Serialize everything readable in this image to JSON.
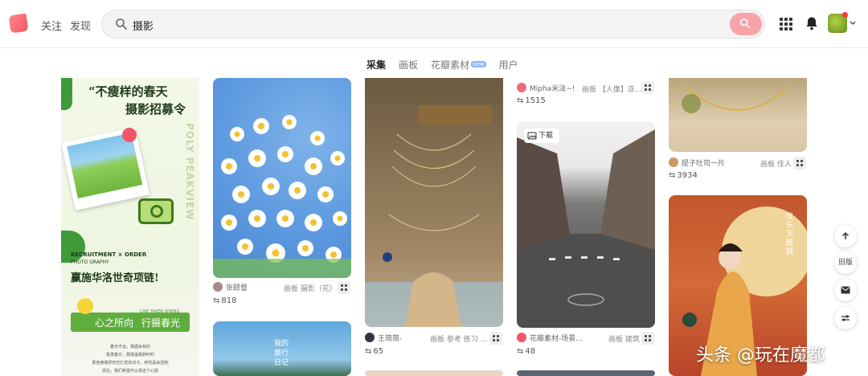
{
  "header": {
    "nav": [
      "关注",
      "发现"
    ],
    "search_value": "摄影"
  },
  "tabs": [
    {
      "label": "采集",
      "active": true
    },
    {
      "label": "画板",
      "active": false
    },
    {
      "label": "花瓣素材",
      "active": false,
      "badge": "new"
    },
    {
      "label": "用户",
      "active": false
    }
  ],
  "pins": {
    "poster": {
      "headline_1": "“不瘦样的春天",
      "headline_2": "摄影招募令",
      "vertical": "POLY PEAKVIEW",
      "recruit": "RECRUITMENT × ORDER",
      "photo": "PHOTO GRAPHY",
      "slogan": "赢施华洛世奇项链!",
      "spring_en": "LINE TAKEN SPRING",
      "spring_1": "心之所向",
      "spring_2": "行摄春光",
      "body_1": "春日不远，相遇会有时",
      "body_2": "笔录春日，那缕温柔醉时时",
      "body_3": "那些被偶然时光打发的日子，终究是会回响",
      "body_4": "现在，我们希望可以将这个心愿"
    },
    "daisy": {
      "user": "张颐督",
      "board": "画板 摄影（花）",
      "count": "818"
    },
    "model": {
      "user": "王简简-",
      "board": "画板 参考 练习 ...",
      "count": "65"
    },
    "mipha": {
      "user": "Mipha米法~!",
      "board": "画板 【人像】亚...",
      "count": "1515"
    },
    "street": {
      "download": "下载",
      "user": "花瓣素材-场景...",
      "board": "画板 建筑",
      "count": "48"
    },
    "neck": {
      "user": "提子吐司一片",
      "board": "画板 佳人",
      "count": "3934"
    },
    "feitian": {
      "title": "伎乐天·腾兢"
    },
    "sky": {
      "text": "我的旅行日记"
    }
  },
  "float": {
    "old": "旧版"
  },
  "watermark": "头条 @玩在魔都",
  "colors": {
    "accent": "#f25566",
    "search_btn": "#f6a3aa"
  }
}
